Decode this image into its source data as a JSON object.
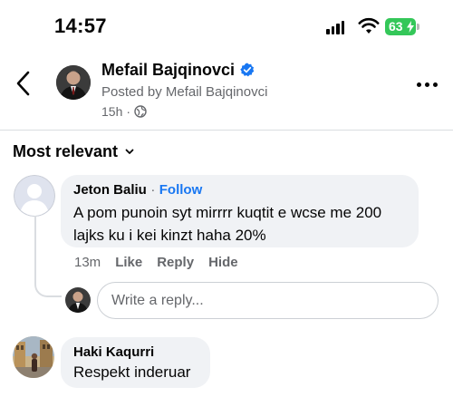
{
  "status_bar": {
    "time": "14:57",
    "battery": "63"
  },
  "post": {
    "author": "Mefail Bajqinovci",
    "posted_by": "Posted by Mefail Bajqinovci",
    "time": "15h",
    "dot": "·"
  },
  "comments": {
    "sort_label": "Most relevant",
    "items": [
      {
        "name": "Jeton Baliu",
        "separator": "·",
        "follow_label": "Follow",
        "text": "A pom punoin syt mirrrr kuqtit e wcse me 200 lajks ku i kei kinzt haha 20%",
        "time": "13m",
        "like": "Like",
        "reply": "Reply",
        "hide": "Hide"
      },
      {
        "name": "Haki Kaqurri",
        "text": "Respekt inderuar"
      }
    ],
    "reply_placeholder": "Write a reply..."
  },
  "colors": {
    "accent": "#1877f2",
    "verified": "#1877f2",
    "battery": "#34c759",
    "bubble": "#f0f2f5",
    "secondary_text": "#65676b"
  },
  "icons": {
    "back": "chevron-left-icon",
    "verified": "verified-badge-icon",
    "privacy": "globe-icon",
    "more": "more-horizontal-icon",
    "sort": "chevron-down-icon"
  }
}
